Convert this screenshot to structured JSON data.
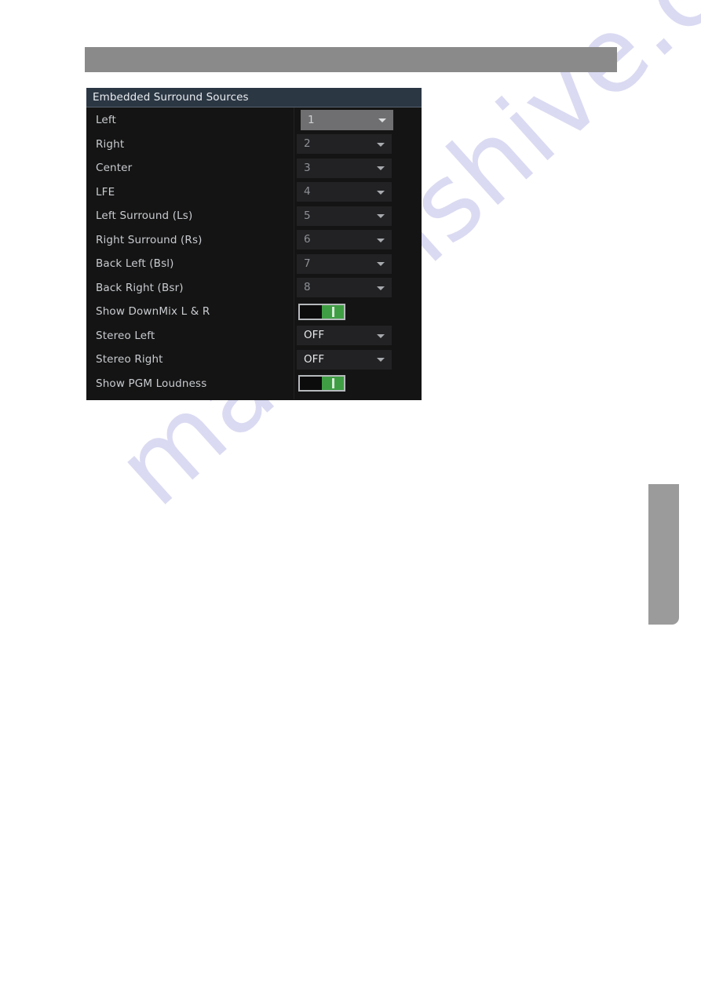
{
  "page": {
    "background_color": "#ffffff",
    "watermark_text": "manualshive.com",
    "watermark_color": "#d9d9f2"
  },
  "top_bar": {
    "label": "",
    "color": "#8a8a8a"
  },
  "side_tab": {
    "label": "",
    "color": "#9b9b9b"
  },
  "panel": {
    "title": "Embedded Surround Sources",
    "title_bar_color": "#2c3744",
    "body_color": "#141414",
    "accent_on_color": "#3f9e44",
    "rows": [
      {
        "label": "Left",
        "control": "dropdown",
        "value": "1",
        "focused": true
      },
      {
        "label": "Right",
        "control": "dropdown",
        "value": "2",
        "focused": false
      },
      {
        "label": "Center",
        "control": "dropdown",
        "value": "3",
        "focused": false
      },
      {
        "label": "LFE",
        "control": "dropdown",
        "value": "4",
        "focused": false
      },
      {
        "label": "Left Surround (Ls)",
        "control": "dropdown",
        "value": "5",
        "focused": false
      },
      {
        "label": "Right Surround (Rs)",
        "control": "dropdown",
        "value": "6",
        "focused": false
      },
      {
        "label": "Back Left (Bsl)",
        "control": "dropdown",
        "value": "7",
        "focused": false
      },
      {
        "label": "Back Right (Bsr)",
        "control": "dropdown",
        "value": "8",
        "focused": false
      },
      {
        "label": "Show DownMix L & R",
        "control": "toggle",
        "value": "ON",
        "focused": false
      },
      {
        "label": "Stereo Left",
        "control": "dropdown",
        "value": "OFF",
        "focused": false
      },
      {
        "label": "Stereo Right",
        "control": "dropdown",
        "value": "OFF",
        "focused": false
      },
      {
        "label": "Show PGM Loudness",
        "control": "toggle",
        "value": "ON",
        "focused": false
      }
    ]
  }
}
